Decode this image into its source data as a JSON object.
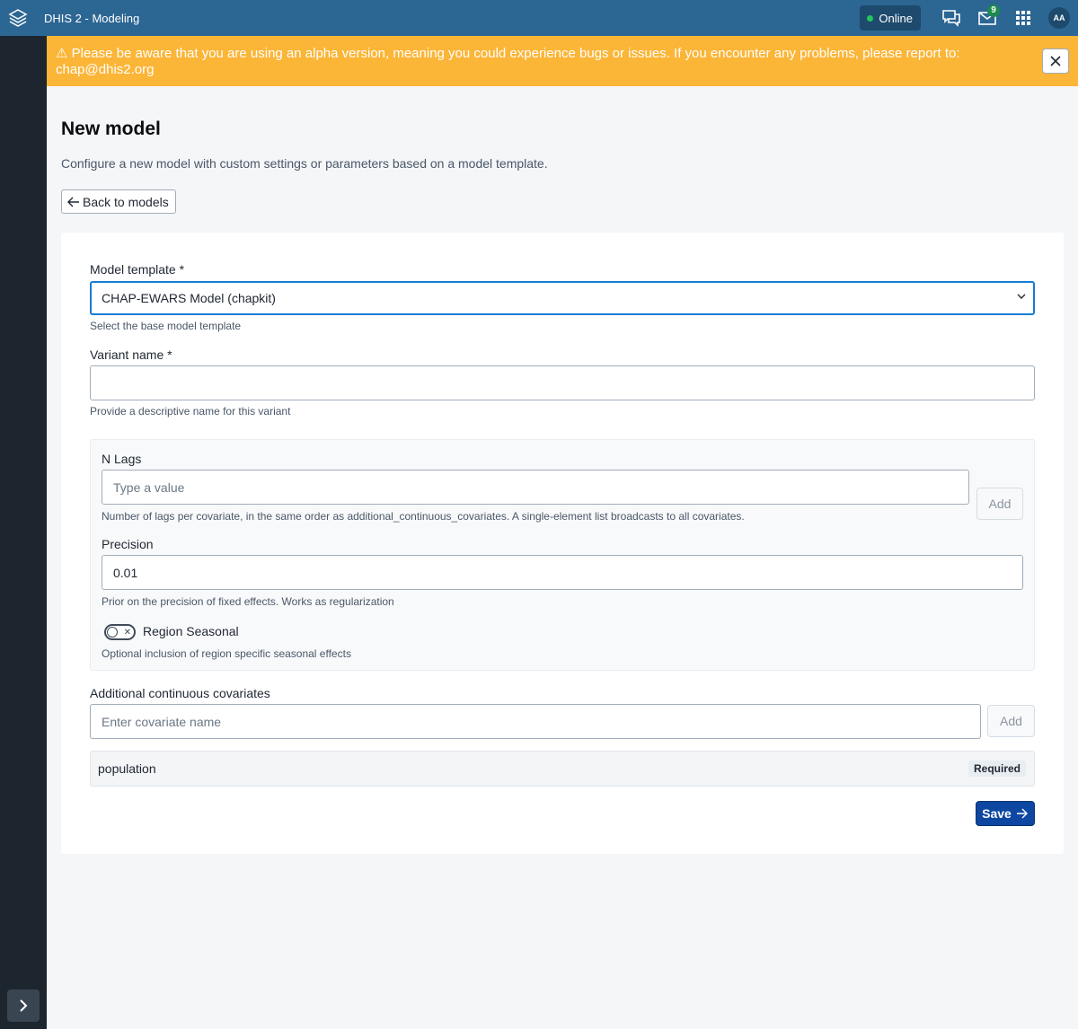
{
  "header": {
    "app_title": "DHIS 2 - Modeling",
    "online_label": "Online",
    "messages_count": "9",
    "avatar_initials": "AA"
  },
  "banner": {
    "icon": "warning-icon",
    "text": "⚠ Please be aware that you are using an alpha version, meaning you could experience bugs or issues. If you encounter any problems, please report to: chap@dhis2.org"
  },
  "page": {
    "title": "New model",
    "description": "Configure a new model with custom settings or parameters based on a model template.",
    "back_label": "Back to models"
  },
  "form": {
    "model_template": {
      "label": "Model template *",
      "value": "CHAP-EWARS Model (chapkit)",
      "help": "Select the base model template"
    },
    "variant_name": {
      "label": "Variant name *",
      "value": "",
      "help": "Provide a descriptive name for this variant"
    },
    "n_lags": {
      "label": "N Lags",
      "placeholder": "Type a value",
      "add_label": "Add",
      "help": "Number of lags per covariate, in the same order as additional_continuous_covariates. A single-element list broadcasts to all covariates."
    },
    "precision": {
      "label": "Precision",
      "value": "0.01",
      "help": "Prior on the precision of fixed effects. Works as regularization"
    },
    "region_seasonal": {
      "label": "Region Seasonal",
      "checked": false,
      "help": "Optional inclusion of region specific seasonal effects"
    },
    "covariates": {
      "label": "Additional continuous covariates",
      "placeholder": "Enter covariate name",
      "add_label": "Add",
      "items": [
        {
          "name": "population",
          "badge": "Required"
        }
      ]
    },
    "save_label": "Save"
  },
  "colors": {
    "header": "#2c6693",
    "banner": "#fbb537",
    "primary": "#0d47a1",
    "sidebar": "#1d252f"
  }
}
